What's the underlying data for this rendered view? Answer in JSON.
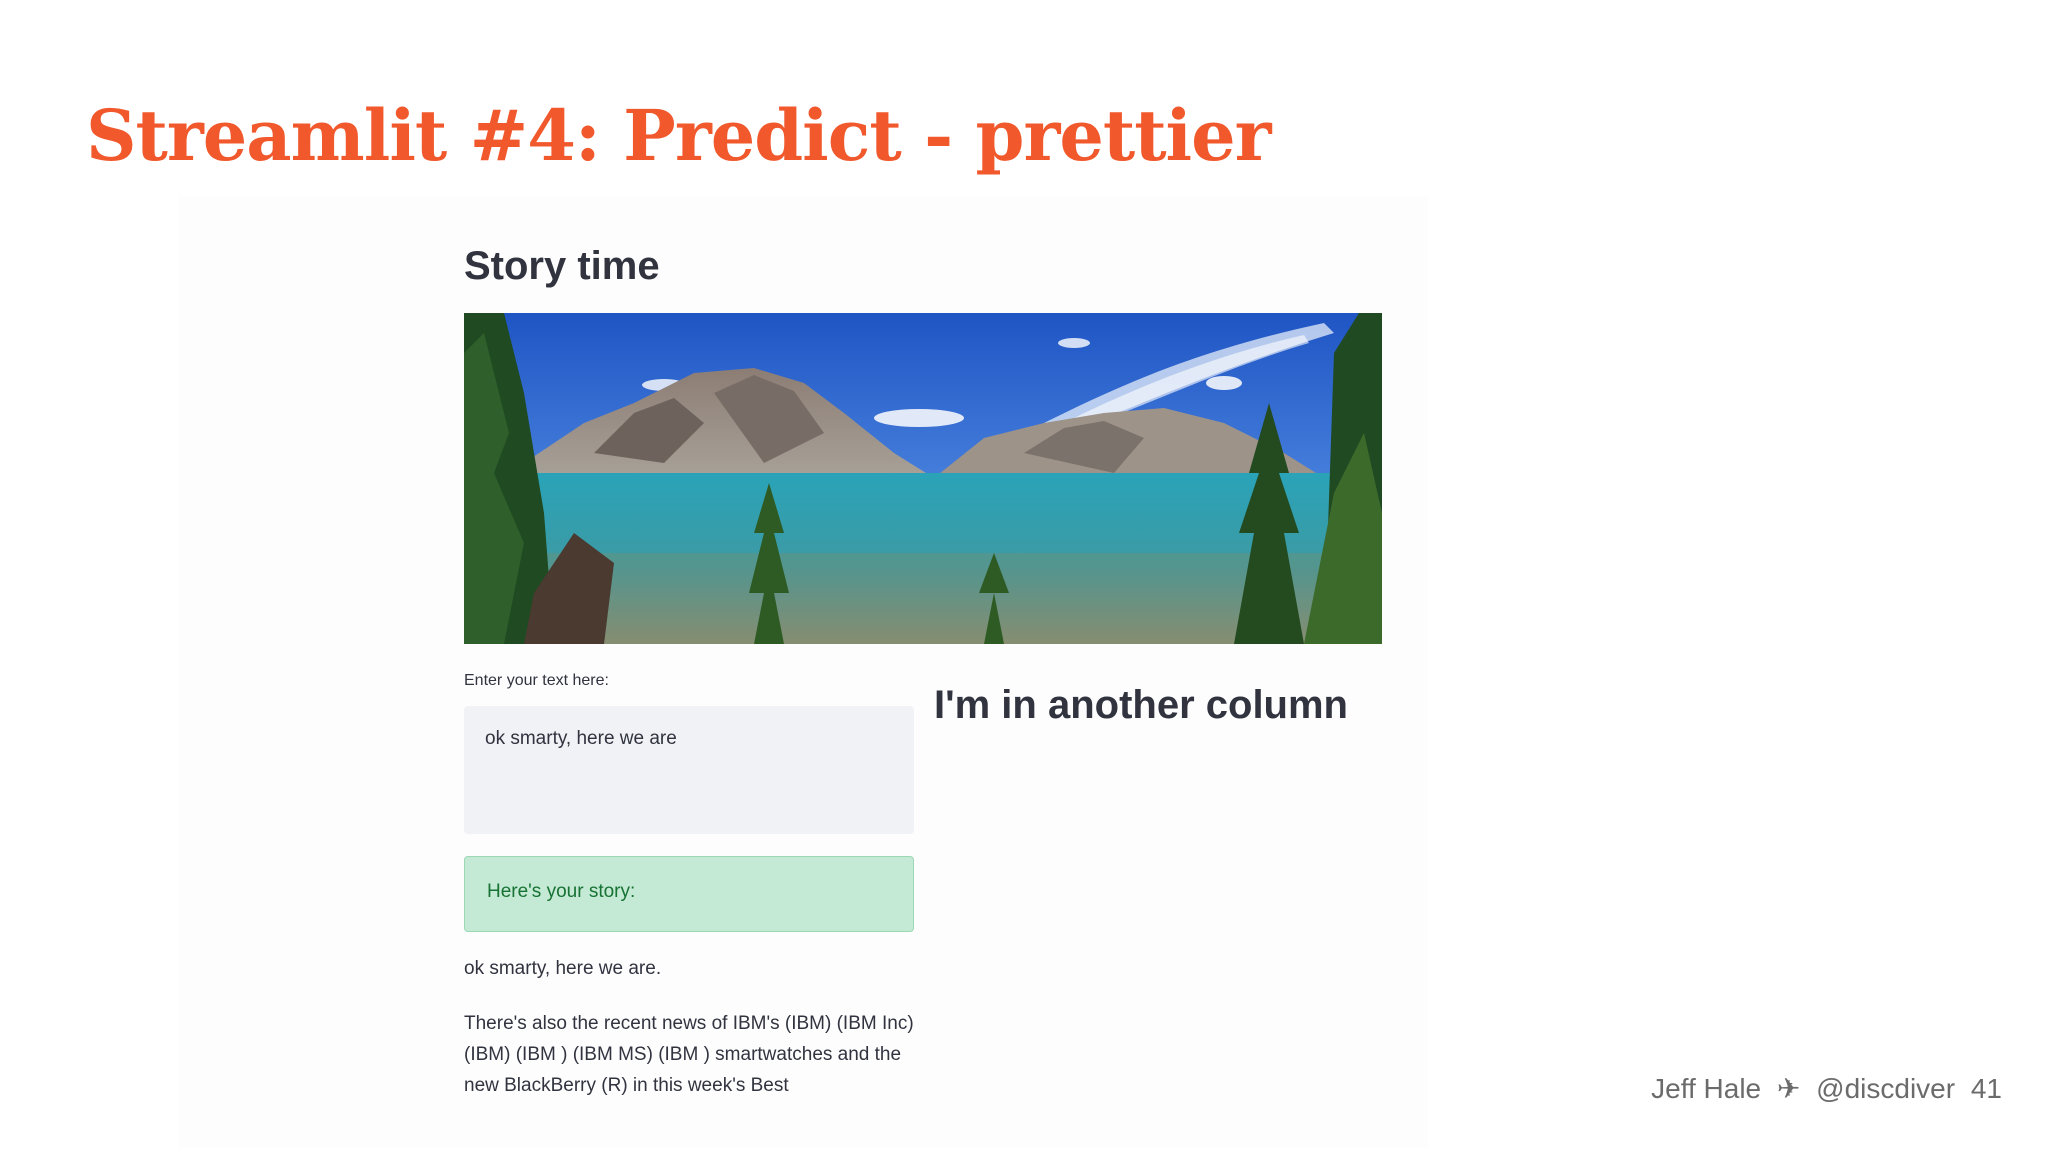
{
  "slide": {
    "title": "Streamlit #4: Predict - prettier",
    "footer": {
      "author": "Jeff Hale",
      "handle": "@discdiver",
      "page_number": "41"
    }
  },
  "app": {
    "heading": "Story time",
    "image_icon": "landscape-photo",
    "input": {
      "label": "Enter your text here:",
      "value": "ok smarty, here we are"
    },
    "success_message": "Here's your story:",
    "story_line": "ok smarty, here we are.",
    "story_paragraph": "There's also the recent news of IBM's (IBM) (IBM Inc) (IBM) (IBM ) (IBM MS) (IBM ) smartwatches and the new BlackBerry (R) in this week's Best",
    "column_heading": "I'm in another column"
  },
  "colors": {
    "title": "#f1582c",
    "text": "#31333f",
    "input_background": "#f0f2f6",
    "success_background": "#c4ead5",
    "success_text": "#177233"
  }
}
